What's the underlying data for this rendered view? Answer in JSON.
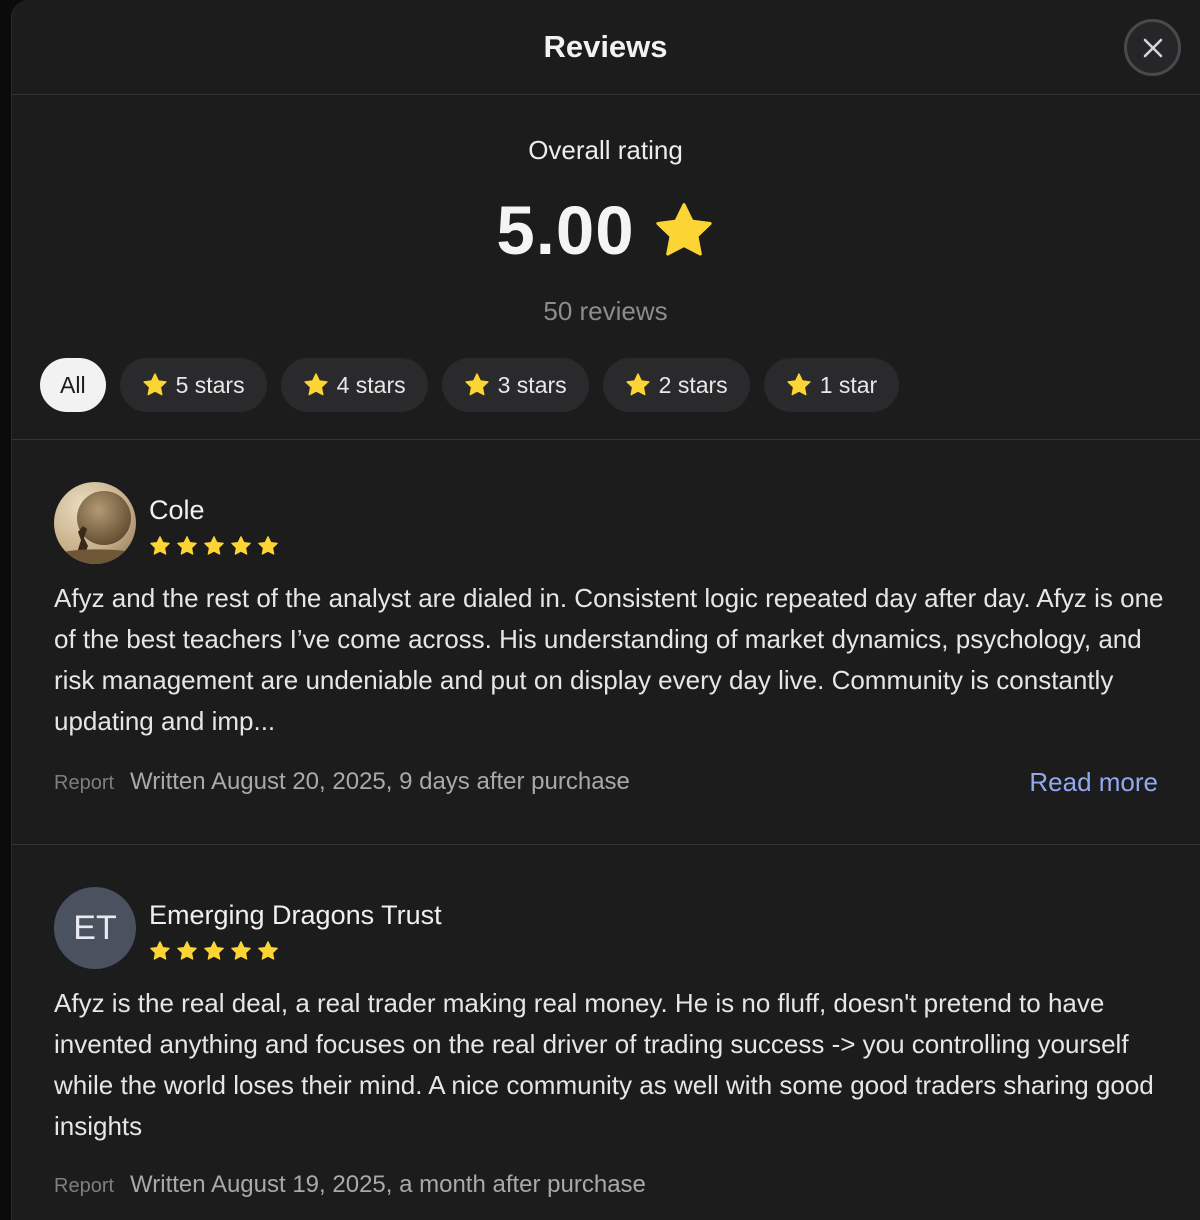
{
  "header": {
    "title": "Reviews",
    "close_icon": "close-icon"
  },
  "summary": {
    "label": "Overall rating",
    "score": "5.00",
    "review_count": "50 reviews",
    "star_color": "#fcd535"
  },
  "filters": [
    {
      "label": "All",
      "active": true,
      "icon": null
    },
    {
      "label": "5 stars",
      "active": false,
      "icon": "star-icon"
    },
    {
      "label": "4 stars",
      "active": false,
      "icon": "star-icon"
    },
    {
      "label": "3 stars",
      "active": false,
      "icon": "star-icon"
    },
    {
      "label": "2 stars",
      "active": false,
      "icon": "star-icon"
    },
    {
      "label": "1 star",
      "active": false,
      "icon": "star-icon"
    }
  ],
  "reviews": [
    {
      "name": "Cole",
      "avatar": "photo",
      "rating": 5,
      "text": "Afyz and the rest of the analyst are dialed in. Consistent logic repeated day after day. Afyz is one of the best teachers I’ve come across. His understanding of market dynamics, psychology, and risk management are undeniable and put on display every day live. Community is constantly updating and imp...",
      "report_label": "Report",
      "written": "Written August 20, 2025, 9 days after purchase",
      "read_more": "Read more"
    },
    {
      "name": "Emerging Dragons Trust",
      "avatar": "ET",
      "rating": 5,
      "text": "Afyz is the real deal, a real trader making real money. He is no fluff, doesn't pretend to have invented anything and focuses on the real driver of trading success -> you controlling yourself while the world loses their mind. A nice community as well with some good traders sharing good insights",
      "report_label": "Report",
      "written": "Written August 19, 2025, a month after purchase"
    }
  ]
}
